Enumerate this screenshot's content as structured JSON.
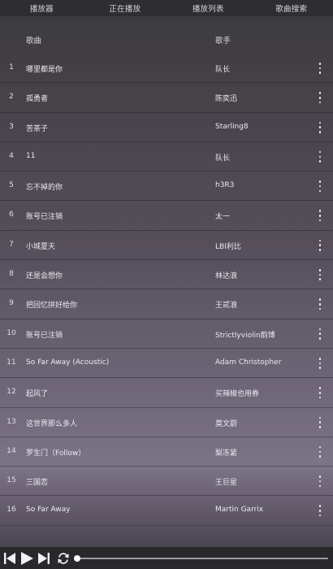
{
  "tabs": [
    {
      "label": "播放器"
    },
    {
      "label": "正在播放"
    },
    {
      "label": "播放列表"
    },
    {
      "label": "歌曲搜索"
    }
  ],
  "header": {
    "title_label": "歌曲",
    "artist_label": "歌手"
  },
  "songs": [
    {
      "index": "1",
      "title": "哪里都是你",
      "artist": "队长"
    },
    {
      "index": "2",
      "title": "孤勇者",
      "artist": "陈奕迅"
    },
    {
      "index": "3",
      "title": "苦茶子",
      "artist": "Starling8"
    },
    {
      "index": "4",
      "title": "11",
      "artist": "队长"
    },
    {
      "index": "5",
      "title": "忘不掉的你",
      "artist": "h3R3"
    },
    {
      "index": "6",
      "title": "账号已注销",
      "artist": "太一"
    },
    {
      "index": "7",
      "title": "小城夏天",
      "artist": "LBI利比"
    },
    {
      "index": "8",
      "title": "还是会想你",
      "artist": "林达浪"
    },
    {
      "index": "9",
      "title": "把回忆拼好给你",
      "artist": "王贰浪"
    },
    {
      "index": "10",
      "title": "账号已注销",
      "artist": "Strictlyviolin韵博"
    },
    {
      "index": "11",
      "title": "So Far Away (Acoustic)",
      "artist": "Adam Christopher"
    },
    {
      "index": "12",
      "title": "起风了",
      "artist": "买辣椒也用券"
    },
    {
      "index": "13",
      "title": "这世界那么多人",
      "artist": "莫文蔚"
    },
    {
      "index": "14",
      "title": "罗生门（Follow）",
      "artist": "梨冻紧"
    },
    {
      "index": "15",
      "title": "三国恋",
      "artist": "王巨星"
    },
    {
      "index": "16",
      "title": "So Far Away",
      "artist": "Martin Garrix"
    }
  ],
  "player": {
    "controls": [
      "previous-icon",
      "play-icon",
      "next-icon",
      "repeat-icon"
    ],
    "progress_fraction": 0.0
  },
  "colors": {
    "tabbar_bg": "#2e2d30",
    "player_bg": "#29282b",
    "text": "#ece9f0"
  }
}
